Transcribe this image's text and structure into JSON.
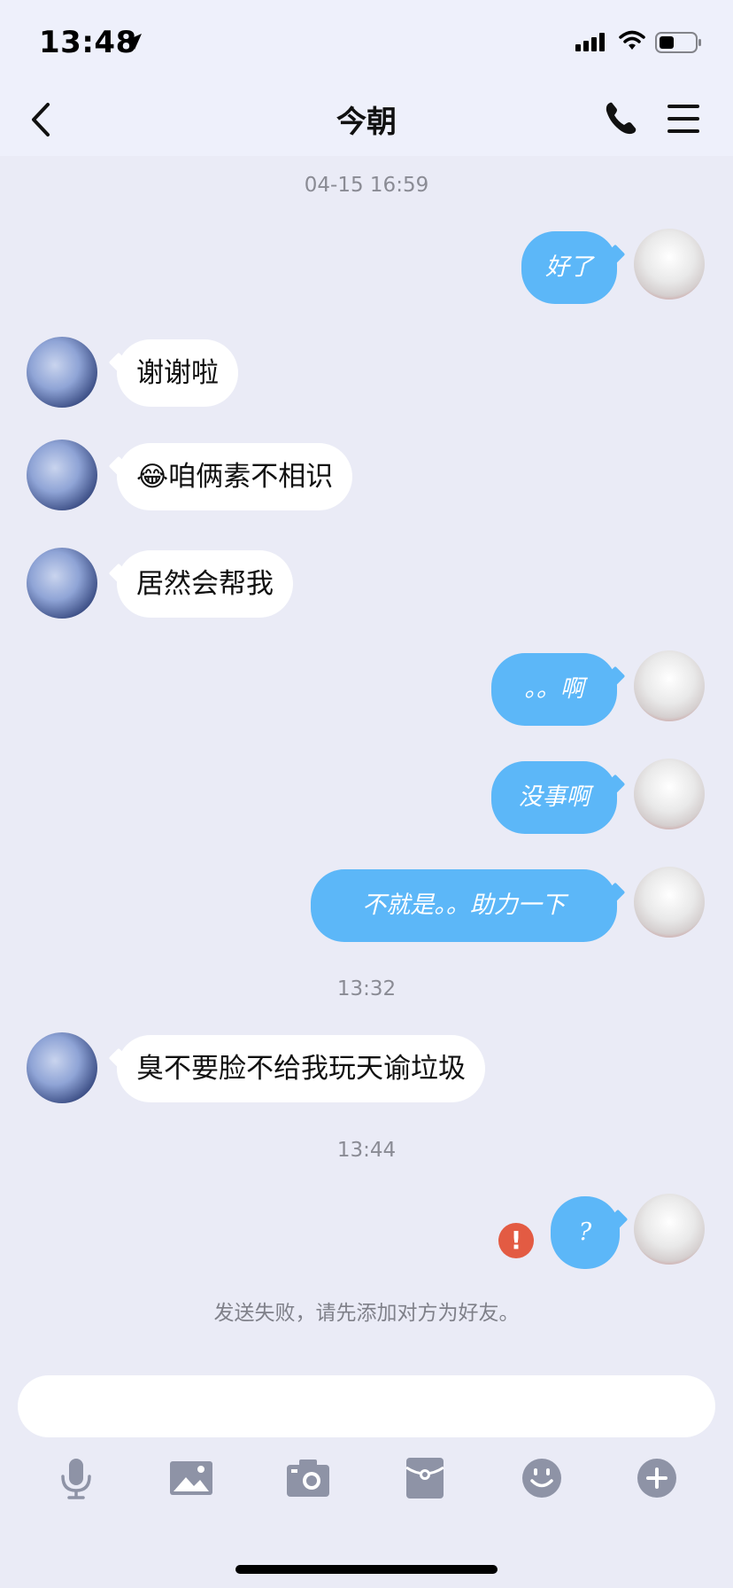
{
  "status_bar": {
    "time": "13:48"
  },
  "header": {
    "title": "今朝"
  },
  "messages": {
    "ts1": "04-15 16:59",
    "m1": "好了",
    "m2": "谢谢啦",
    "m3": "😂咱俩素不相识",
    "m4": "居然会帮我",
    "m5": "。。啊",
    "m6": "没事啊",
    "m7": "不就是。。助力一下",
    "ts2": "13:32",
    "m8": "臭不要脸不给我玩天谕垃圾",
    "ts3": "13:44",
    "m9": "?",
    "error_glyph": "!",
    "system_note": "发送失败，请先添加对方为好友。"
  },
  "toolbar": {
    "icons": [
      "microphone-icon",
      "image-icon",
      "camera-icon",
      "red-packet-icon",
      "emoji-icon",
      "plus-icon"
    ]
  },
  "colors": {
    "bubble_out": "#5cb7f8",
    "bubble_in": "#ffffff",
    "background": "#eaebf6",
    "error": "#e35b43",
    "toolbar_icon": "#8e93a6"
  }
}
